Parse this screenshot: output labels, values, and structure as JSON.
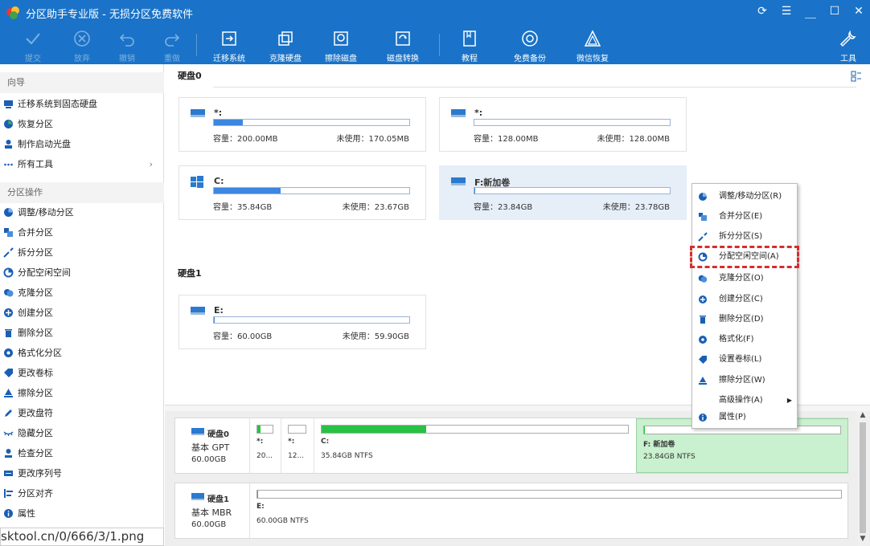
{
  "window": {
    "title": "分区助手专业版 - 无损分区免费软件",
    "controls": [
      "refresh-icon",
      "menu-icon",
      "minimize-icon",
      "maximize-icon",
      "close-icon"
    ]
  },
  "toolbar": {
    "submit": "提交",
    "discard": "放弃",
    "undo": "撤销",
    "redo": "重做",
    "migrate": "迁移系统",
    "clone": "克隆硬盘",
    "wipe": "擦除磁盘",
    "convert": "磁盘转换",
    "tutorial": "教程",
    "backup": "免费备份",
    "wechat": "微信恢复",
    "tools": "工具"
  },
  "sidebar": {
    "wizard_title": "向导",
    "wizard_items": [
      {
        "label": "迁移系统到固态硬盘"
      },
      {
        "label": "恢复分区"
      },
      {
        "label": "制作启动光盘"
      },
      {
        "label": "所有工具"
      }
    ],
    "ops_title": "分区操作",
    "ops_items": [
      {
        "label": "调整/移动分区"
      },
      {
        "label": "合并分区"
      },
      {
        "label": "拆分分区"
      },
      {
        "label": "分配空闲空间"
      },
      {
        "label": "克隆分区"
      },
      {
        "label": "创建分区"
      },
      {
        "label": "删除分区"
      },
      {
        "label": "格式化分区"
      },
      {
        "label": "更改卷标"
      },
      {
        "label": "擦除分区"
      },
      {
        "label": "更改盘符"
      },
      {
        "label": "隐藏分区"
      },
      {
        "label": "检查分区"
      },
      {
        "label": "更改序列号"
      },
      {
        "label": "分区对齐"
      },
      {
        "label": "属性"
      }
    ]
  },
  "main": {
    "disk0_label": "硬盘0",
    "disk1_label": "硬盘1",
    "cards": [
      {
        "name": "*:",
        "cap": "容量：200.00MB",
        "free": "未使用：170.05MB",
        "used_fraction": 0.15
      },
      {
        "name": "*:",
        "cap": "容量：128.00MB",
        "free": "未使用：128.00MB",
        "used_fraction": 0.0
      },
      {
        "name": "C:",
        "cap": "容量：35.84GB",
        "free": "未使用：23.67GB",
        "used_fraction": 0.34
      },
      {
        "name": "F:新加卷",
        "cap": "容量：23.84GB",
        "free": "未使用：23.78GB",
        "used_fraction": 0.003
      },
      {
        "name": "E:",
        "cap": "容量：60.00GB",
        "free": "未使用：59.90GB",
        "used_fraction": 0.002
      }
    ]
  },
  "diskmap": {
    "disk0": {
      "name": "硬盘0",
      "type": "基本 GPT",
      "size": "60.00GB",
      "parts": [
        {
          "name": "*:",
          "detail": "20...",
          "used_fraction": 0.2
        },
        {
          "name": "*:",
          "detail": "12...",
          "used_fraction": 0.0
        },
        {
          "name": "C:",
          "detail": "35.84GB NTFS",
          "used_fraction": 0.34
        },
        {
          "name": "F: 新加卷",
          "detail": "23.84GB NTFS",
          "used_fraction": 0.003
        }
      ]
    },
    "disk1": {
      "name": "硬盘1",
      "type": "基本 MBR",
      "size": "60.00GB",
      "parts": [
        {
          "name": "E:",
          "detail": "60.00GB NTFS",
          "used_fraction": 0.002
        }
      ]
    }
  },
  "context_menu": {
    "items": [
      {
        "label": "调整/移动分区(R)"
      },
      {
        "label": "合并分区(E)"
      },
      {
        "label": "拆分分区(S)"
      },
      {
        "label": "分配空闲空间(A)"
      },
      {
        "label": "克隆分区(O)"
      },
      {
        "label": "创建分区(C)"
      },
      {
        "label": "删除分区(D)"
      },
      {
        "label": "格式化(F)"
      },
      {
        "label": "设置卷标(L)"
      },
      {
        "label": "擦除分区(W)"
      },
      {
        "label": "高级操作(A)"
      },
      {
        "label": "属性(P)"
      }
    ]
  },
  "watermark": {
    "url": "sktool.cn/0/666/3/1.png"
  },
  "colors": {
    "titlebar": "#1a73c8",
    "accent": "#3c87e0",
    "partition_used": "#27c244",
    "selected_partition": "#c9f0cf",
    "highlight": "#d32f2f"
  }
}
